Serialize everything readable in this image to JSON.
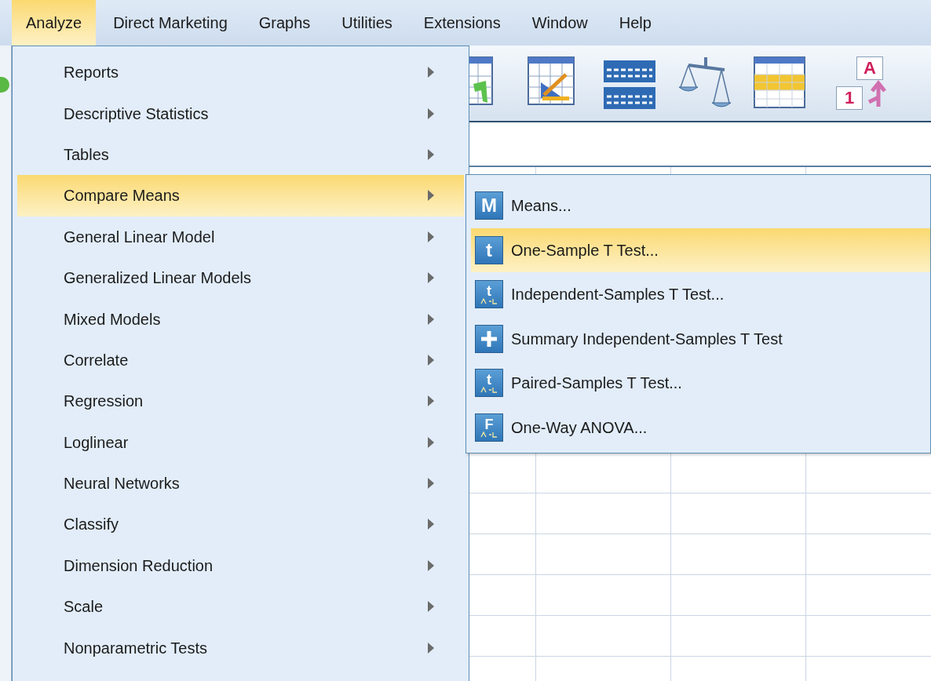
{
  "menubar": [
    {
      "label": "Analyze",
      "selected": true
    },
    {
      "label": "Direct Marketing",
      "selected": false
    },
    {
      "label": "Graphs",
      "selected": false
    },
    {
      "label": "Utilities",
      "selected": false
    },
    {
      "label": "Extensions",
      "selected": false
    },
    {
      "label": "Window",
      "selected": false
    },
    {
      "label": "Help",
      "selected": false
    }
  ],
  "toolbar": [
    {
      "kind": "table-arrow"
    },
    {
      "kind": "table-ruler"
    },
    {
      "kind": "two-tables"
    },
    {
      "kind": "scales"
    },
    {
      "kind": "table-highlight"
    },
    {
      "kind": "value-labels",
      "letters": [
        "A",
        "1"
      ]
    }
  ],
  "analyze_menu": [
    {
      "label": "Reports",
      "selected": false
    },
    {
      "label": "Descriptive Statistics",
      "selected": false
    },
    {
      "label": "Tables",
      "selected": false
    },
    {
      "label": "Compare Means",
      "selected": true
    },
    {
      "label": "General Linear Model",
      "selected": false
    },
    {
      "label": "Generalized Linear Models",
      "selected": false
    },
    {
      "label": "Mixed Models",
      "selected": false
    },
    {
      "label": "Correlate",
      "selected": false
    },
    {
      "label": "Regression",
      "selected": false
    },
    {
      "label": "Loglinear",
      "selected": false
    },
    {
      "label": "Neural Networks",
      "selected": false
    },
    {
      "label": "Classify",
      "selected": false
    },
    {
      "label": "Dimension Reduction",
      "selected": false
    },
    {
      "label": "Scale",
      "selected": false
    },
    {
      "label": "Nonparametric Tests",
      "selected": false
    }
  ],
  "compare_means_submenu": [
    {
      "label": "Means...",
      "kind": "letter",
      "icon_text": "M",
      "selected": false
    },
    {
      "label": "One-Sample T Test...",
      "kind": "letter",
      "icon_text": "t",
      "selected": true
    },
    {
      "label": "Independent-Samples T Test...",
      "kind": "letter-sub",
      "icon_text": "t",
      "selected": false
    },
    {
      "label": "Summary Independent-Samples T Test",
      "kind": "plus",
      "selected": false
    },
    {
      "label": "Paired-Samples T Test...",
      "kind": "letter-sub",
      "icon_text": "t",
      "selected": false
    },
    {
      "label": "One-Way ANOVA...",
      "kind": "letter-sub",
      "icon_text": "F",
      "selected": false
    }
  ]
}
